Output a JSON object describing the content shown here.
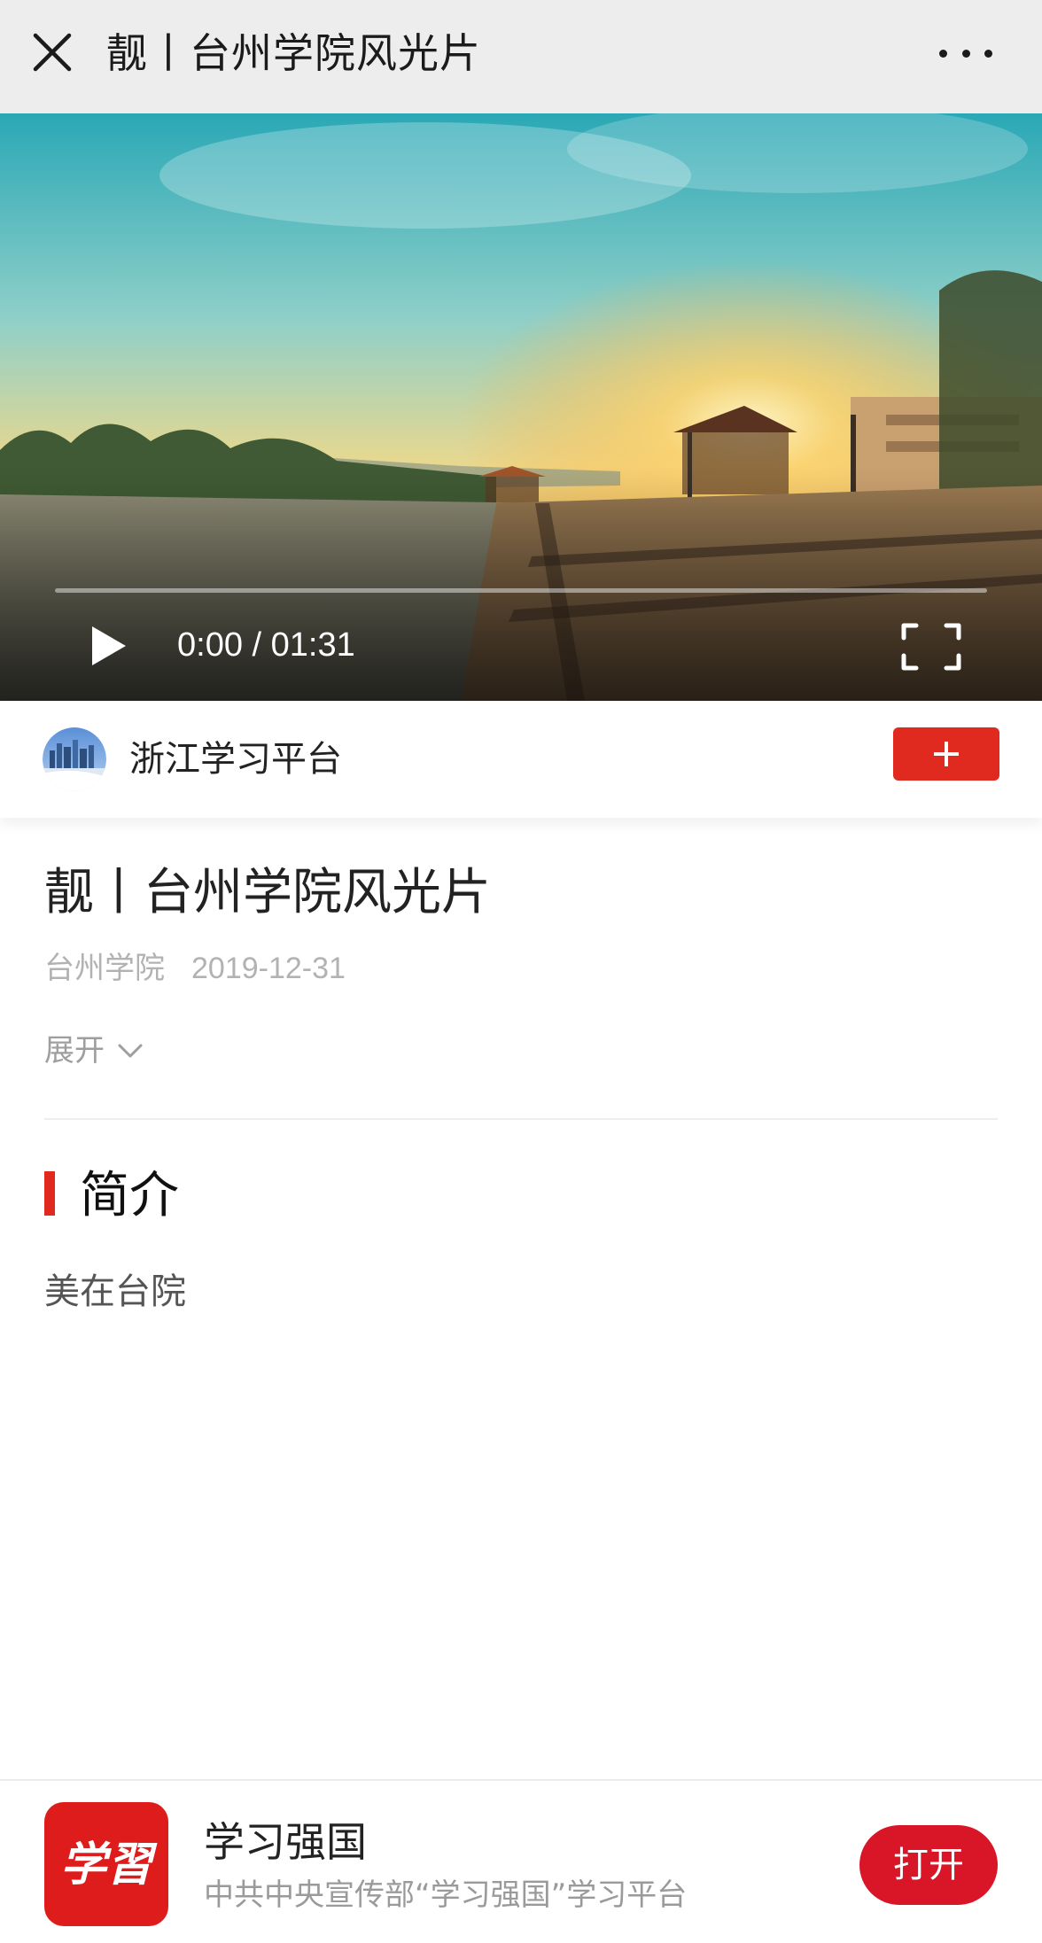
{
  "header": {
    "title": "靓丨台州学院风光片",
    "close_icon": "close-icon",
    "more_icon": "more-icon"
  },
  "video": {
    "time": "0:00 / 01:31",
    "progress": 0.0,
    "play_icon": "play-icon",
    "fullscreen_icon": "fullscreen-icon"
  },
  "account": {
    "name": "浙江学习平台",
    "follow_icon": "plus-icon",
    "accent": "#e02a1f"
  },
  "article": {
    "title": "靓丨台州学院风光片",
    "source": "台州学院",
    "date": "2019-12-31",
    "expand_label": "展开",
    "section_title": "简介",
    "summary": "美在台院"
  },
  "banner": {
    "app_name": "学习强国",
    "app_desc": "中共中央宣传部“学习强国”学习平台",
    "logo_text": "学習",
    "open_label": "打开",
    "brand_color": "#d91528"
  }
}
